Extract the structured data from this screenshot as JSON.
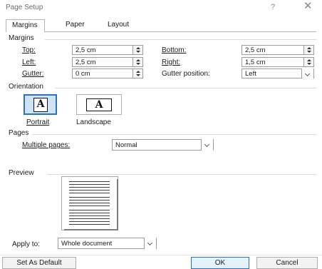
{
  "window": {
    "title": "Page Setup",
    "help_glyph": "?",
    "close_glyph": "✕"
  },
  "tabs": [
    {
      "label": "Margins",
      "active": true
    },
    {
      "label": "Paper",
      "active": false
    },
    {
      "label": "Layout",
      "active": false
    }
  ],
  "margins": {
    "group_label": "Margins",
    "top": {
      "label": "Top:",
      "value": "2,5 cm"
    },
    "bottom": {
      "label": "Bottom:",
      "value": "2,5 cm"
    },
    "left": {
      "label": "Left:",
      "value": "2,5 cm"
    },
    "right": {
      "label": "Right:",
      "value": "1,5 cm"
    },
    "gutter": {
      "label": "Gutter:",
      "value": "0 cm"
    },
    "gutter_position": {
      "label": "Gutter position:",
      "value": "Left"
    }
  },
  "orientation": {
    "group_label": "Orientation",
    "portrait_label": "Portrait",
    "landscape_label": "Landscape",
    "icon_letter": "A",
    "selected": "portrait"
  },
  "pages": {
    "group_label": "Pages",
    "multiple_pages_label": "Multiple pages:",
    "multiple_pages_value": "Normal"
  },
  "preview": {
    "group_label": "Preview"
  },
  "apply_to": {
    "label": "Apply to:",
    "value": "Whole document"
  },
  "buttons": {
    "set_default": "Set As Default",
    "ok": "OK",
    "cancel": "Cancel"
  },
  "colors": {
    "selection_border": "#2b71c2",
    "selection_fill": "#cde3f7",
    "title_text": "#6b6b6b"
  }
}
